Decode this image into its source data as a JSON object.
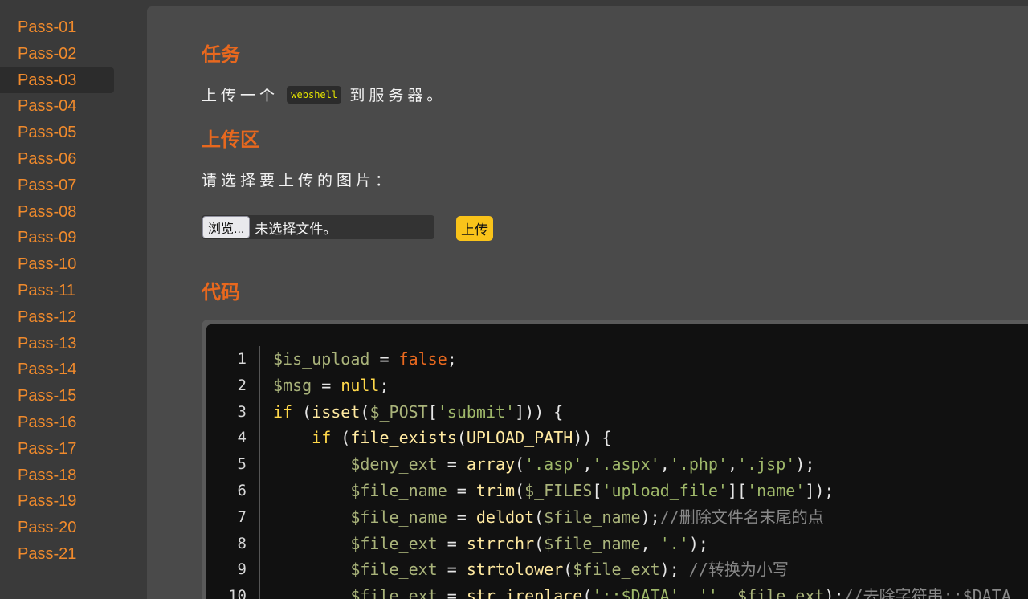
{
  "sidebar": {
    "items": [
      "Pass-01",
      "Pass-02",
      "Pass-03",
      "Pass-04",
      "Pass-05",
      "Pass-06",
      "Pass-07",
      "Pass-08",
      "Pass-09",
      "Pass-10",
      "Pass-11",
      "Pass-12",
      "Pass-13",
      "Pass-14",
      "Pass-15",
      "Pass-16",
      "Pass-17",
      "Pass-18",
      "Pass-19",
      "Pass-20",
      "Pass-21"
    ],
    "active_index": 2
  },
  "task": {
    "heading": "任务",
    "text_before": "上传一个",
    "code_word": "webshell",
    "text_after": "到服务器。"
  },
  "upload": {
    "heading": "上传区",
    "prompt": "请选择要上传的图片：",
    "browse_label": "浏览...",
    "file_status": "未选择文件。",
    "submit_label": "上传"
  },
  "code": {
    "heading": "代码",
    "line_numbers": [
      "1",
      "2",
      "3",
      "4",
      "5",
      "6",
      "7",
      "8",
      "9",
      "10"
    ],
    "lines": [
      [
        [
          "v",
          "$is_upload"
        ],
        [
          "p",
          " = "
        ],
        [
          "f",
          "false"
        ],
        [
          "p",
          ";"
        ]
      ],
      [
        [
          "v",
          "$msg"
        ],
        [
          "p",
          " = "
        ],
        [
          "kw",
          "null"
        ],
        [
          "p",
          ";"
        ]
      ],
      [
        [
          "kw",
          "if"
        ],
        [
          "p",
          " ("
        ],
        [
          "fn",
          "isset"
        ],
        [
          "p",
          "("
        ],
        [
          "v",
          "$_POST"
        ],
        [
          "p",
          "["
        ],
        [
          "s",
          "'submit'"
        ],
        [
          "p",
          "])) {"
        ]
      ],
      [
        [
          "p",
          "    "
        ],
        [
          "kw",
          "if"
        ],
        [
          "p",
          " ("
        ],
        [
          "fn",
          "file_exists"
        ],
        [
          "p",
          "("
        ],
        [
          "fn",
          "UPLOAD_PATH"
        ],
        [
          "p",
          ")) {"
        ]
      ],
      [
        [
          "p",
          "        "
        ],
        [
          "v",
          "$deny_ext"
        ],
        [
          "p",
          " = "
        ],
        [
          "fn",
          "array"
        ],
        [
          "p",
          "("
        ],
        [
          "s",
          "'.asp'"
        ],
        [
          "p",
          ","
        ],
        [
          "s",
          "'.aspx'"
        ],
        [
          "p",
          ","
        ],
        [
          "s",
          "'.php'"
        ],
        [
          "p",
          ","
        ],
        [
          "s",
          "'.jsp'"
        ],
        [
          "p",
          ");"
        ]
      ],
      [
        [
          "p",
          "        "
        ],
        [
          "v",
          "$file_name"
        ],
        [
          "p",
          " = "
        ],
        [
          "fn",
          "trim"
        ],
        [
          "p",
          "("
        ],
        [
          "v",
          "$_FILES"
        ],
        [
          "p",
          "["
        ],
        [
          "s",
          "'upload_file'"
        ],
        [
          "p",
          "]["
        ],
        [
          "s",
          "'name'"
        ],
        [
          "p",
          "]);"
        ]
      ],
      [
        [
          "p",
          "        "
        ],
        [
          "v",
          "$file_name"
        ],
        [
          "p",
          " = "
        ],
        [
          "fn",
          "deldot"
        ],
        [
          "p",
          "("
        ],
        [
          "v",
          "$file_name"
        ],
        [
          "p",
          ");"
        ],
        [
          "c",
          "//删除文件名末尾的点"
        ]
      ],
      [
        [
          "p",
          "        "
        ],
        [
          "v",
          "$file_ext"
        ],
        [
          "p",
          " = "
        ],
        [
          "fn",
          "strrchr"
        ],
        [
          "p",
          "("
        ],
        [
          "v",
          "$file_name"
        ],
        [
          "p",
          ", "
        ],
        [
          "s",
          "'.'"
        ],
        [
          "p",
          ");"
        ]
      ],
      [
        [
          "p",
          "        "
        ],
        [
          "v",
          "$file_ext"
        ],
        [
          "p",
          " = "
        ],
        [
          "fn",
          "strtolower"
        ],
        [
          "p",
          "("
        ],
        [
          "v",
          "$file_ext"
        ],
        [
          "p",
          "); "
        ],
        [
          "c",
          "//转换为小写"
        ]
      ],
      [
        [
          "p",
          "        "
        ],
        [
          "v",
          "$file_ext"
        ],
        [
          "p",
          " = "
        ],
        [
          "fn",
          "str_ireplace"
        ],
        [
          "p",
          "("
        ],
        [
          "s",
          "'::$DATA'"
        ],
        [
          "p",
          ", "
        ],
        [
          "s",
          "''"
        ],
        [
          "p",
          ", "
        ],
        [
          "v",
          "$file_ext"
        ],
        [
          "p",
          ");"
        ],
        [
          "c",
          "//去除字符串::$DATA"
        ]
      ]
    ]
  }
}
